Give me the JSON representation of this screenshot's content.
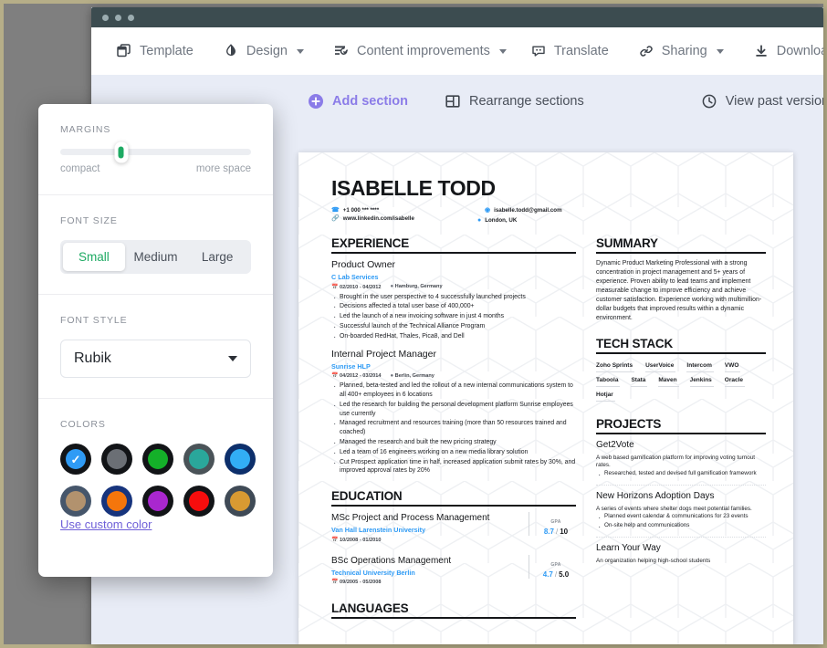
{
  "window": {
    "dots": 3
  },
  "toolbar": {
    "items": [
      {
        "label": "Template",
        "icon": "template-icon",
        "caret": false
      },
      {
        "label": "Design",
        "icon": "design-contrast-icon",
        "caret": true
      },
      {
        "label": "Content improvements",
        "icon": "content-improvements-icon",
        "caret": true
      },
      {
        "label": "Translate",
        "icon": "translate-icon",
        "caret": false
      },
      {
        "label": "Sharing",
        "icon": "link-icon",
        "caret": true
      },
      {
        "label": "Download",
        "icon": "download-icon",
        "caret": false
      }
    ]
  },
  "subbar": {
    "add_section": "Add section",
    "rearrange": "Rearrange sections",
    "versions": "View past versions",
    "accent_color": "#8b7ce8"
  },
  "settings_panel": {
    "margins": {
      "label": "MARGINS",
      "left_end": "compact",
      "right_end": "more space",
      "value_pct": 32,
      "thumb_color": "#1eaa63"
    },
    "font_size": {
      "label": "FONT SIZE",
      "options": [
        "Small",
        "Medium",
        "Large"
      ],
      "selected": "Small",
      "active_color": "#1eaa63"
    },
    "font_style": {
      "label": "FONT STYLE",
      "selected": "Rubik"
    },
    "colors": {
      "label": "COLORS",
      "custom_link": "Use custom color",
      "selected_index": 0,
      "swatches": [
        {
          "inner": "#2f9bf5",
          "ring": "#121417",
          "selected": true
        },
        {
          "inner": "#6b6f75",
          "ring": "#121417",
          "selected": false
        },
        {
          "inner": "#14b029",
          "ring": "#121417",
          "selected": false
        },
        {
          "inner": "#2aa79b",
          "ring": "#4a5358",
          "selected": false
        },
        {
          "inner": "#32aef5",
          "ring": "#0d2f6b",
          "selected": false
        },
        {
          "inner": "#b2926e",
          "ring": "#46566b",
          "selected": false
        },
        {
          "inner": "#f5760c",
          "ring": "#17347d",
          "selected": false
        },
        {
          "inner": "#a927cf",
          "ring": "#121417",
          "selected": false
        },
        {
          "inner": "#f60d0d",
          "ring": "#121417",
          "selected": false
        },
        {
          "inner": "#d99a32",
          "ring": "#3f4a56",
          "selected": false
        }
      ]
    }
  },
  "resume": {
    "name": "ISABELLE TODD",
    "contacts": {
      "phone": "+1 000 *** ****",
      "location": "London, UK",
      "email": "isabelle.todd@gmail.com",
      "linkedin": "www.linkedin.com/isabelle"
    },
    "experience": {
      "heading": "EXPERIENCE",
      "jobs": [
        {
          "title": "Product Owner",
          "org": "C Lab Services",
          "dates": "02/2010 - 04/2012",
          "place": "Hamburg, Germany",
          "bullets": [
            "Brought in the user perspective to 4 successfully launched projects",
            "Decisions affected a total user base of 400,000+",
            "Led the launch of a new invoicing software in just 4 months",
            "Successful launch of the Technical Alliance Program",
            "On-boarded RedHat, Thales, Pica8, and Dell"
          ]
        },
        {
          "title": "Internal Project Manager",
          "org": "Sunrise HLP",
          "dates": "04/2012 - 03/2014",
          "place": "Berlin, Germany",
          "bullets": [
            "Planned, beta-tested and led the rollout of a new internal communications system to all 400+ employees in 6 locations",
            "Led the research for building the personal development platform Sunrise employees use currently",
            "Managed recruitment and resources training (more than 50 resources trained and coached)",
            "Managed the research and built the new pricing strategy",
            "Led a team of 16 engineers working on a new media library solution",
            "Cut Prospect application time in half, increased application submit rates by 30%, and improved approval rates by 20%"
          ]
        }
      ]
    },
    "education": {
      "heading": "EDUCATION",
      "items": [
        {
          "degree": "MSc Project and Process Management",
          "school": "Van Hall Larenstein University",
          "dates": "10/2008 - 01/2010",
          "gpa_label": "GPA",
          "gpa_value": "8.7",
          "gpa_max": "10"
        },
        {
          "degree": "BSc Operations Management",
          "school": "Technical University Berlin",
          "dates": "09/2005 - 05/2008",
          "gpa_label": "GPA",
          "gpa_value": "4.7",
          "gpa_max": "5.0"
        }
      ]
    },
    "languages": {
      "heading": "LANGUAGES"
    },
    "summary": {
      "heading": "SUMMARY",
      "text": "Dynamic Product Marketing Professional with a strong concentration in project management and 5+ years of experience. Proven ability to lead teams and implement measurable change to improve efficiency and achieve customer satisfaction. Experience working with multimillion-dollar budgets that improved results within a dynamic environment."
    },
    "tech_stack": {
      "heading": "TECH STACK",
      "tags": [
        "Zoho Sprints",
        "UserVoice",
        "Intercom",
        "VWO",
        "Taboola",
        "Stata",
        "Maven",
        "Jenkins",
        "Oracle",
        "Hotjar"
      ]
    },
    "projects": {
      "heading": "PROJECTS",
      "items": [
        {
          "name": "Get2Vote",
          "desc": "A web based gamification platform for improving voting turnout rates.",
          "bullets": [
            "Researched, tested and devised full gamification framework"
          ]
        },
        {
          "name": "New Horizons Adoption Days",
          "desc": "A series of events where shelter dogs meet potential families.",
          "bullets": [
            "Planned event calendar & communications for 23 events",
            "On-site help and communications"
          ]
        },
        {
          "name": "Learn Your Way",
          "desc": "An organization helping high-school students",
          "bullets": []
        }
      ]
    }
  }
}
